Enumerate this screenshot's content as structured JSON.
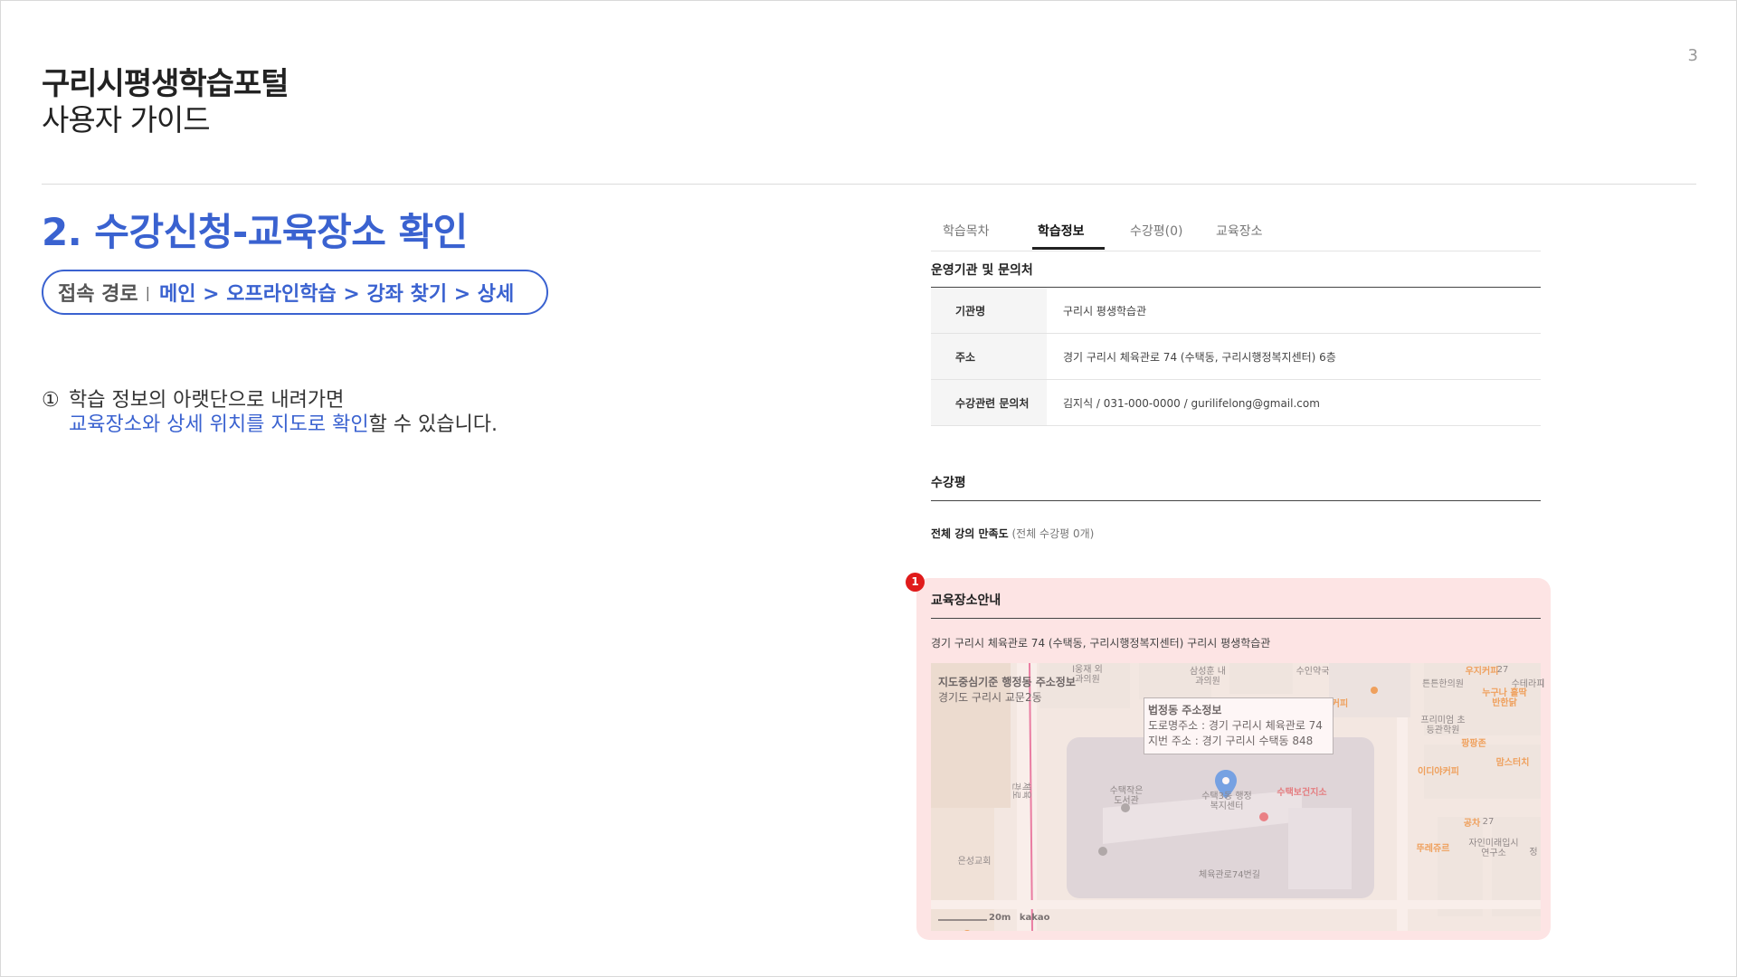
{
  "page_number": "3",
  "header": {
    "title": "구리시평생학습포털",
    "subtitle": "사용자 가이드"
  },
  "section": {
    "title": "2. 수강신청-교육장소 확인",
    "path_label": "접속 경로",
    "path_separator": "|",
    "path_route": "메인 > 오프라인학습 > 강좌 찾기 > 상세",
    "step_mark": "①",
    "step_line1": "학습 정보의 아랫단으로 내려가면",
    "step_line2_highlight": "교육장소와 상세 위치를 지도로 확인",
    "step_line2_rest": "할 수 있습니다."
  },
  "screenshot": {
    "tabs": [
      {
        "label": "학습목차"
      },
      {
        "label": "학습정보"
      },
      {
        "label": "수강평(0)"
      },
      {
        "label": "교육장소"
      }
    ],
    "org_title": "운영기관 및 문의처",
    "org_rows": [
      {
        "label": "기관명",
        "value": "구리시 평생학습관"
      },
      {
        "label": "주소",
        "value": "경기 구리시 체육관로 74 (수택동, 구리시행정복지센터) 6층"
      },
      {
        "label": "수강관련 문의처",
        "value": "김지식 / 031-000-0000 / gurilifelong@gmail.com"
      }
    ],
    "review_title": "수강평",
    "satisfaction_label": "전체 강의 만족도",
    "satisfaction_count": "(전체 수강평 0개)",
    "badge": "1",
    "location_title": "교육장소안내",
    "location_address": "경기 구리시 체육관로 74 (수택동, 구리시행정복지센터) 구리시 평생학습관",
    "map": {
      "admin_title": "지도중심기준 행정동 주소정보",
      "admin_value": "경기도 구리시 교문2동",
      "legal_title": "법정동 주소정보",
      "road_address": "도로명주소 : 경기 구리시 체육관로 74",
      "lot_address": "지번 주소 : 경기 구리시 수택동 848",
      "labels": {
        "l1": "l웅재 외과의원",
        "l2": "삼성훈 내과의원",
        "l3": "수인약국",
        "l4": "튼튼한의원",
        "l5": "우지커피",
        "l6": "누구나 홀딱반한닭",
        "l7": "수테라피",
        "l8": "커피",
        "l9": "프리미엄 초등관학원",
        "l10": "팡팡존",
        "l11": "맘스터치",
        "l12": "이디야커피",
        "l13": "수택작은 도서관",
        "l14": "수택3동 행정복지센터",
        "l15": "수택보건지소",
        "l16": "공차",
        "l17": "뚜레쥬르",
        "l18": "자인미래입시 연구소",
        "l19": "은성교회",
        "l20": "체육관로74번길",
        "l21": "체육관로",
        "l22": "27",
        "l23": "27",
        "l24": "정"
      },
      "scale": "20m",
      "provider": "kakao"
    }
  }
}
